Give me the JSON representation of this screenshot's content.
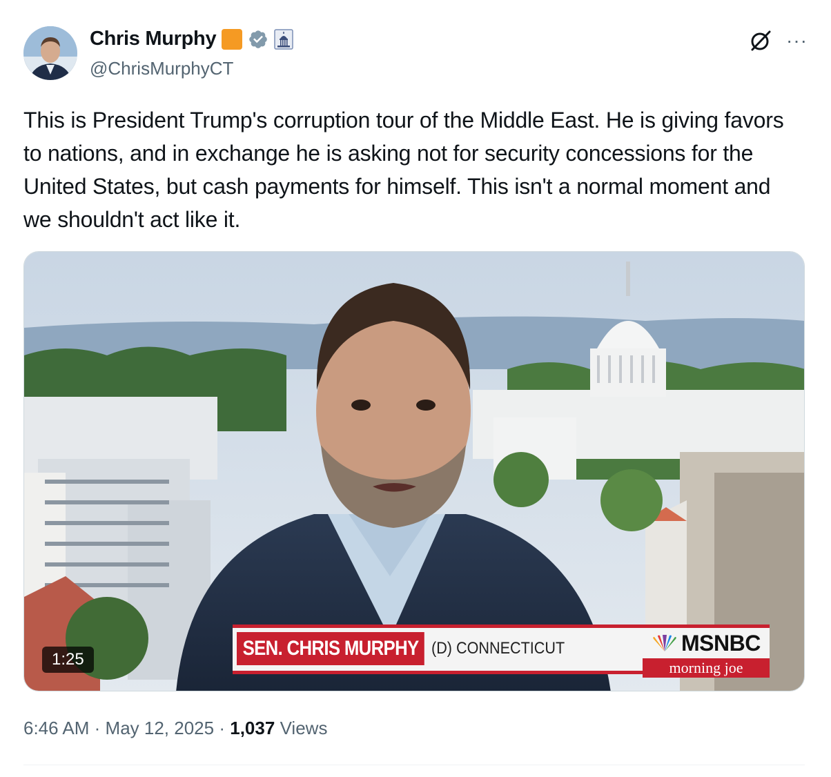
{
  "author": {
    "display_name": "Chris Murphy",
    "handle": "@ChrisMurphyCT",
    "badges": [
      "orange-square",
      "verified-badge-icon",
      "capitol-icon"
    ]
  },
  "actions": {
    "grok_icon": "grok-icon",
    "more_label": "···"
  },
  "tweet": {
    "text": "This is President Trump's corruption tour of the Middle East. He is giving favors to nations, and in exchange he is asking not for security concessions for the United States, but cash payments for himself. This isn't a normal moment and we shouldn't act like it."
  },
  "video": {
    "duration": "1:25",
    "chyron_name": "SEN. CHRIS MURPHY",
    "chyron_state": "(D) CONNECTICUT",
    "network": "MSNBC",
    "show": "morning joe"
  },
  "meta": {
    "time": "6:46 AM",
    "separator": "·",
    "date": "May 12, 2025",
    "views_count": "1,037",
    "views_label": "Views"
  },
  "colors": {
    "text": "#0f1419",
    "secondary": "#536471",
    "verified": "#829aab",
    "orange": "#f59a23",
    "chyron_red": "#c8202f"
  }
}
